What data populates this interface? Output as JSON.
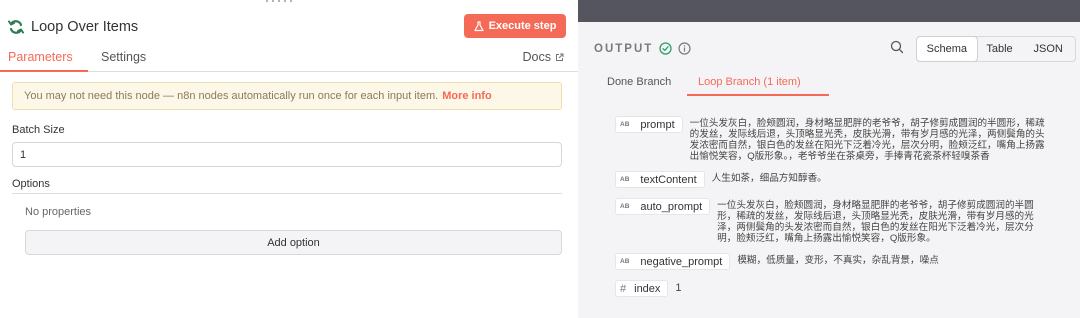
{
  "node": {
    "title": "Loop Over Items",
    "execute_label": "Execute step"
  },
  "tabs": {
    "parameters": "Parameters",
    "settings": "Settings",
    "docs": "Docs"
  },
  "notice": {
    "text": "You may not need this node — n8n nodes automatically run once for each input item.",
    "link": "More info"
  },
  "params": {
    "batch_size_label": "Batch Size",
    "batch_size_value": "1",
    "options_label": "Options",
    "no_properties": "No properties",
    "add_option": "Add option"
  },
  "output": {
    "title": "OUTPUT",
    "views": [
      "Schema",
      "Table",
      "JSON"
    ],
    "selected_view": "Schema",
    "branches": [
      "Done Branch",
      "Loop Branch (1 item)"
    ],
    "active_branch": "Loop Branch (1 item)",
    "fields": [
      {
        "type": "AB",
        "key": "prompt",
        "lines": [
          "一位头发灰白，脸颊圆润，身材略显肥胖的老爷爷，胡子修剪成圆润的半圆形，稀疏",
          "的发丝，发际线后退，头顶略显光秃，皮肤光滑，带有岁月感的光泽，两侧鬓角的头",
          "发浓密而自然，银白色的发丝在阳光下泛着冷光，层次分明，脸颊泛红，嘴角上扬露",
          "出愉悦笑容，Q版形象。，老爷爷坐在茶桌旁，手捧青花瓷茶杯轻嗅茶香"
        ]
      },
      {
        "type": "AB",
        "key": "textContent",
        "lines": [
          "人生如茶，细品方知醇香。"
        ]
      },
      {
        "type": "AB",
        "key": "auto_prompt",
        "lines": [
          "一位头发灰白，脸颊圆润，身材略显肥胖的老爷爷，胡子修剪成圆润的半圆",
          "形，稀疏的发丝，发际线后退，头顶略显光秃，皮肤光滑，带有岁月感的光",
          "泽，两侧鬓角的头发浓密而自然，银白色的发丝在阳光下泛着冷光，层次分",
          "明，脸颊泛红，嘴角上扬露出愉悦笑容，Q版形象。"
        ]
      },
      {
        "type": "AB",
        "key": "negative_prompt",
        "lines": [
          "模糊，低质量，变形，不真实，杂乱背景，噪点"
        ]
      },
      {
        "type": "#",
        "key": "index",
        "value": "1"
      }
    ]
  },
  "colors": {
    "accent": "#f56a57",
    "success": "#2e9e6a",
    "panel_bg": "#f4f4f6"
  }
}
